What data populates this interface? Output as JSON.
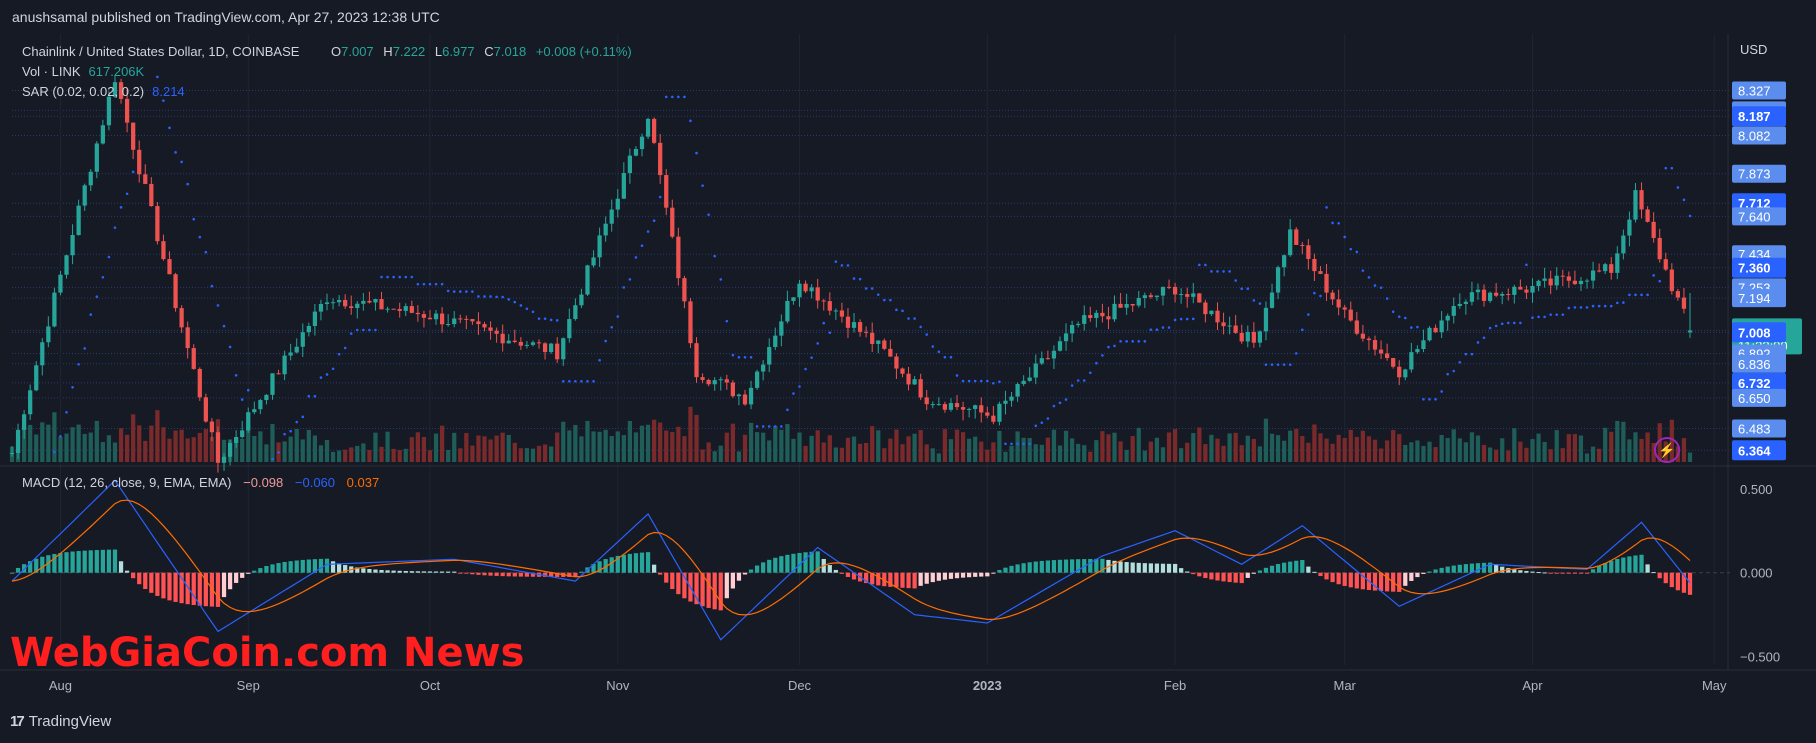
{
  "header": {
    "published": "anushsamal published on TradingView.com, Apr 27, 2023 12:38 UTC"
  },
  "legend": {
    "symbol": "Chainlink / United States Dollar, 1D, COINBASE",
    "o_label": "O",
    "o": "7.007",
    "h_label": "H",
    "h": "7.222",
    "l_label": "L",
    "l": "6.977",
    "c_label": "C",
    "c": "7.018",
    "change": "+0.008 (+0.11%)",
    "vol_label": "Vol · LINK",
    "vol_value": "617.206K",
    "sar_label": "SAR (0.02, 0.02, 0.2)",
    "sar_value": "8.214",
    "macd_label": "MACD (12, 26, close, 9, EMA, EMA)",
    "macd_hist": "−0.098",
    "macd_line": "−0.060",
    "macd_signal": "0.037"
  },
  "colors": {
    "background": "#161a25",
    "up": "#26a69a",
    "down": "#ef5350",
    "sar": "#2962ff",
    "macd_line": "#2962ff",
    "signal_line": "#ff6d00",
    "price_tag": "#26a69a",
    "level_tag": "#2962ff",
    "watermark": "#ff1f1f"
  },
  "price_axis": {
    "currency": "USD",
    "labels": [
      "8.327",
      "8.219",
      "8.187",
      "8.082",
      "7.873",
      "7.712",
      "7.640",
      "7.434",
      "7.360",
      "7.253",
      "7.194",
      "7.018",
      "7.008",
      "6.892",
      "6.836",
      "6.732",
      "6.650",
      "6.483",
      "6.364"
    ],
    "highlighted": [
      "8.187",
      "7.712",
      "7.360",
      "7.008",
      "6.732",
      "6.364"
    ],
    "current_price": "7.018",
    "countdown": "11:22:00"
  },
  "macd_axis": {
    "labels": [
      "0.500",
      "0.000",
      "−0.500"
    ]
  },
  "time_axis": {
    "labels": [
      "Aug",
      "Sep",
      "Oct",
      "Nov",
      "Dec",
      "2023",
      "Feb",
      "Mar",
      "Apr",
      "May"
    ],
    "bold": "2023"
  },
  "chart_data": {
    "type": "candlestick",
    "symbol": "LINKUSD",
    "interval": "1D",
    "last": {
      "open": 7.007,
      "high": 7.222,
      "low": 6.977,
      "close": 7.018
    },
    "price_anchors": [
      {
        "label": "Jul 24",
        "close": 6.35
      },
      {
        "label": "Aug 10",
        "close": 8.4
      },
      {
        "label": "Aug 27",
        "close": 6.3
      },
      {
        "label": "Sep 14",
        "close": 7.2
      },
      {
        "label": "Oct 1",
        "close": 7.1
      },
      {
        "label": "Oct 22",
        "close": 6.9
      },
      {
        "label": "Nov 6",
        "close": 8.2
      },
      {
        "label": "Nov 14",
        "close": 6.8
      },
      {
        "label": "Nov 22",
        "close": 6.65
      },
      {
        "label": "Dec 1",
        "close": 7.3
      },
      {
        "label": "Dec 15",
        "close": 6.9
      },
      {
        "label": "Dec 22",
        "close": 6.65
      },
      {
        "label": "Jan 2",
        "close": 6.55
      },
      {
        "label": "Jan 16",
        "close": 7.05
      },
      {
        "label": "Feb 1",
        "close": 7.25
      },
      {
        "label": "Feb 14",
        "close": 6.95
      },
      {
        "label": "Feb 20",
        "close": 7.55
      },
      {
        "label": "Mar 1",
        "close": 7.1
      },
      {
        "label": "Mar 10",
        "close": 6.8
      },
      {
        "label": "Mar 20",
        "close": 7.2
      },
      {
        "label": "Apr 1",
        "close": 7.25
      },
      {
        "label": "Apr 14",
        "close": 7.35
      },
      {
        "label": "Apr 18",
        "close": 7.75
      },
      {
        "label": "Apr 27",
        "close": 7.018
      }
    ],
    "macd_anchors": [
      {
        "label": "Jul 24",
        "macd": -0.05
      },
      {
        "label": "Aug 10",
        "macd": 0.55
      },
      {
        "label": "Aug 27",
        "macd": -0.35
      },
      {
        "label": "Sep 14",
        "macd": 0.05
      },
      {
        "label": "Oct 5",
        "macd": 0.08
      },
      {
        "label": "Oct 25",
        "macd": -0.05
      },
      {
        "label": "Nov 6",
        "macd": 0.35
      },
      {
        "label": "Nov 18",
        "macd": -0.4
      },
      {
        "label": "Dec 4",
        "macd": 0.15
      },
      {
        "label": "Dec 20",
        "macd": -0.25
      },
      {
        "label": "Jan 1",
        "macd": -0.3
      },
      {
        "label": "Jan 20",
        "macd": 0.1
      },
      {
        "label": "Feb 1",
        "macd": 0.25
      },
      {
        "label": "Feb 12",
        "macd": 0.05
      },
      {
        "label": "Feb 22",
        "macd": 0.28
      },
      {
        "label": "Mar 10",
        "macd": -0.2
      },
      {
        "label": "Mar 25",
        "macd": 0.05
      },
      {
        "label": "Apr 10",
        "macd": 0.02
      },
      {
        "label": "Apr 19",
        "macd": 0.3
      },
      {
        "label": "Apr 27",
        "macd": -0.06
      }
    ],
    "price_range": [
      6.3,
      8.45
    ],
    "macd_range": [
      -0.55,
      0.6
    ],
    "grid": true
  },
  "watermark": "WebGiaCoin.com News",
  "footer": {
    "brand": "TradingView"
  }
}
